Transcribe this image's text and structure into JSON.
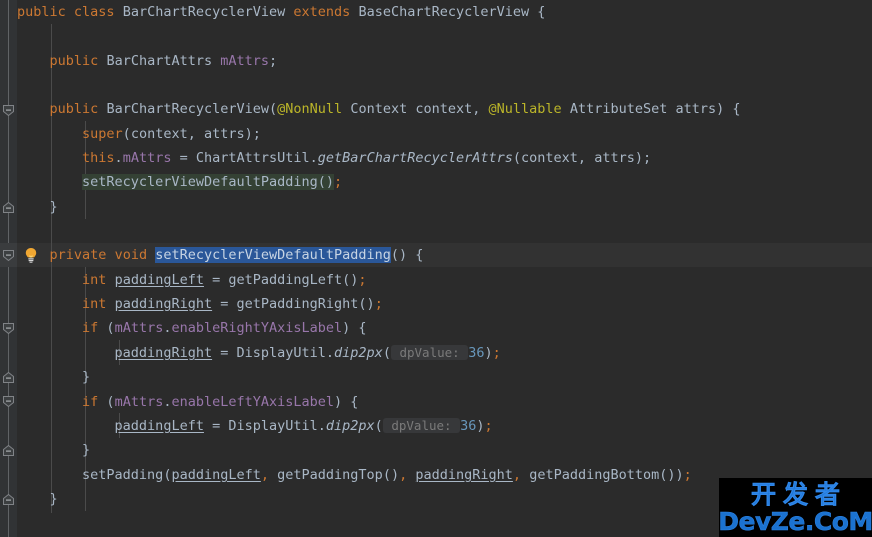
{
  "editor": {
    "theme": "darcula",
    "background": "#2b2b2b",
    "gutter_background": "#313335",
    "caret_line_background": "#323232",
    "selection_color": "#2a5799",
    "usage_highlight_color": "#344134",
    "default_text_color": "#a9b7c6",
    "keyword_color": "#cc7832",
    "field_color": "#9876aa",
    "annotation_color": "#bbb529",
    "number_color": "#6897bb",
    "inlay_hint_color": "#7a7a7a"
  },
  "code": {
    "lines": [
      "public class BarChartRecyclerView extends BaseChartRecyclerView {",
      "",
      "    public BarChartAttrs mAttrs;",
      "",
      "    public BarChartRecyclerView(@NonNull Context context, @Nullable AttributeSet attrs) {",
      "        super(context, attrs);",
      "        this.mAttrs = ChartAttrsUtil.getBarChartRecyclerAttrs(context, attrs);",
      "        setRecyclerViewDefaultPadding();",
      "    }",
      "",
      "    private void setRecyclerViewDefaultPadding() {",
      "        int paddingLeft = getPaddingLeft();",
      "        int paddingRight = getPaddingRight();",
      "        if (mAttrs.enableRightYAxisLabel) {",
      "            paddingRight = DisplayUtil.dip2px( dpValue: 36);",
      "        }",
      "        if (mAttrs.enableLeftYAxisLabel) {",
      "            paddingLeft = DisplayUtil.dip2px( dpValue: 36);",
      "        }",
      "        setPadding(paddingLeft, getPaddingTop(), paddingRight, getPaddingBottom());",
      "    }"
    ],
    "class_name": "BarChartRecyclerView",
    "super_class": "BaseChartRecyclerView",
    "field_name": "mAttrs",
    "field_type": "BarChartAttrs",
    "selected_identifier": "setRecyclerViewDefaultPadding",
    "highlighted_usage": "setRecyclerViewDefaultPadding",
    "inlay_hint_label": "dpValue:",
    "inlay_hint_value": "36"
  },
  "gutter": {
    "fold_markers": [
      {
        "type": "fold-start",
        "line": 4
      },
      {
        "type": "fold-end",
        "line": 8
      },
      {
        "type": "fold-start",
        "line": 10
      },
      {
        "type": "fold-start",
        "line": 13
      },
      {
        "type": "fold-end",
        "line": 15
      },
      {
        "type": "fold-start",
        "line": 16
      },
      {
        "type": "fold-end",
        "line": 18
      },
      {
        "type": "fold-end",
        "line": 20
      }
    ],
    "intention_bulb": {
      "name": "lightbulb-icon",
      "line": 10,
      "color": "#f0a732"
    }
  },
  "watermark": {
    "chinese": "开发者",
    "latin": "DevZe.CoM",
    "color": "#1b72d0",
    "background": "#000000"
  }
}
